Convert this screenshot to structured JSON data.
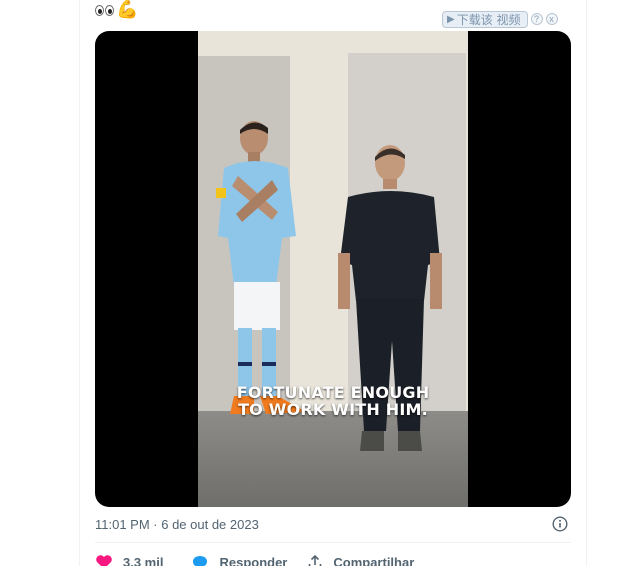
{
  "tweet": {
    "emojis": [
      "eyes-emoji",
      "flexed-biceps-emoji"
    ]
  },
  "downloader": {
    "label": "下载该 视频",
    "help": "?",
    "close": "x"
  },
  "video": {
    "caption_line1": "FORTUNATE ENOUGH",
    "caption_line2": "TO WORK WITH HIM."
  },
  "meta": {
    "timestamp": "11:01 PM · 6 de out de 2023"
  },
  "actions": {
    "likes": "3,3 mil",
    "reply_label": "Responder",
    "share_label": "Compartilhar"
  },
  "colors": {
    "like": "#f91880",
    "reply": "#1d9bf0",
    "muted": "#536471"
  }
}
